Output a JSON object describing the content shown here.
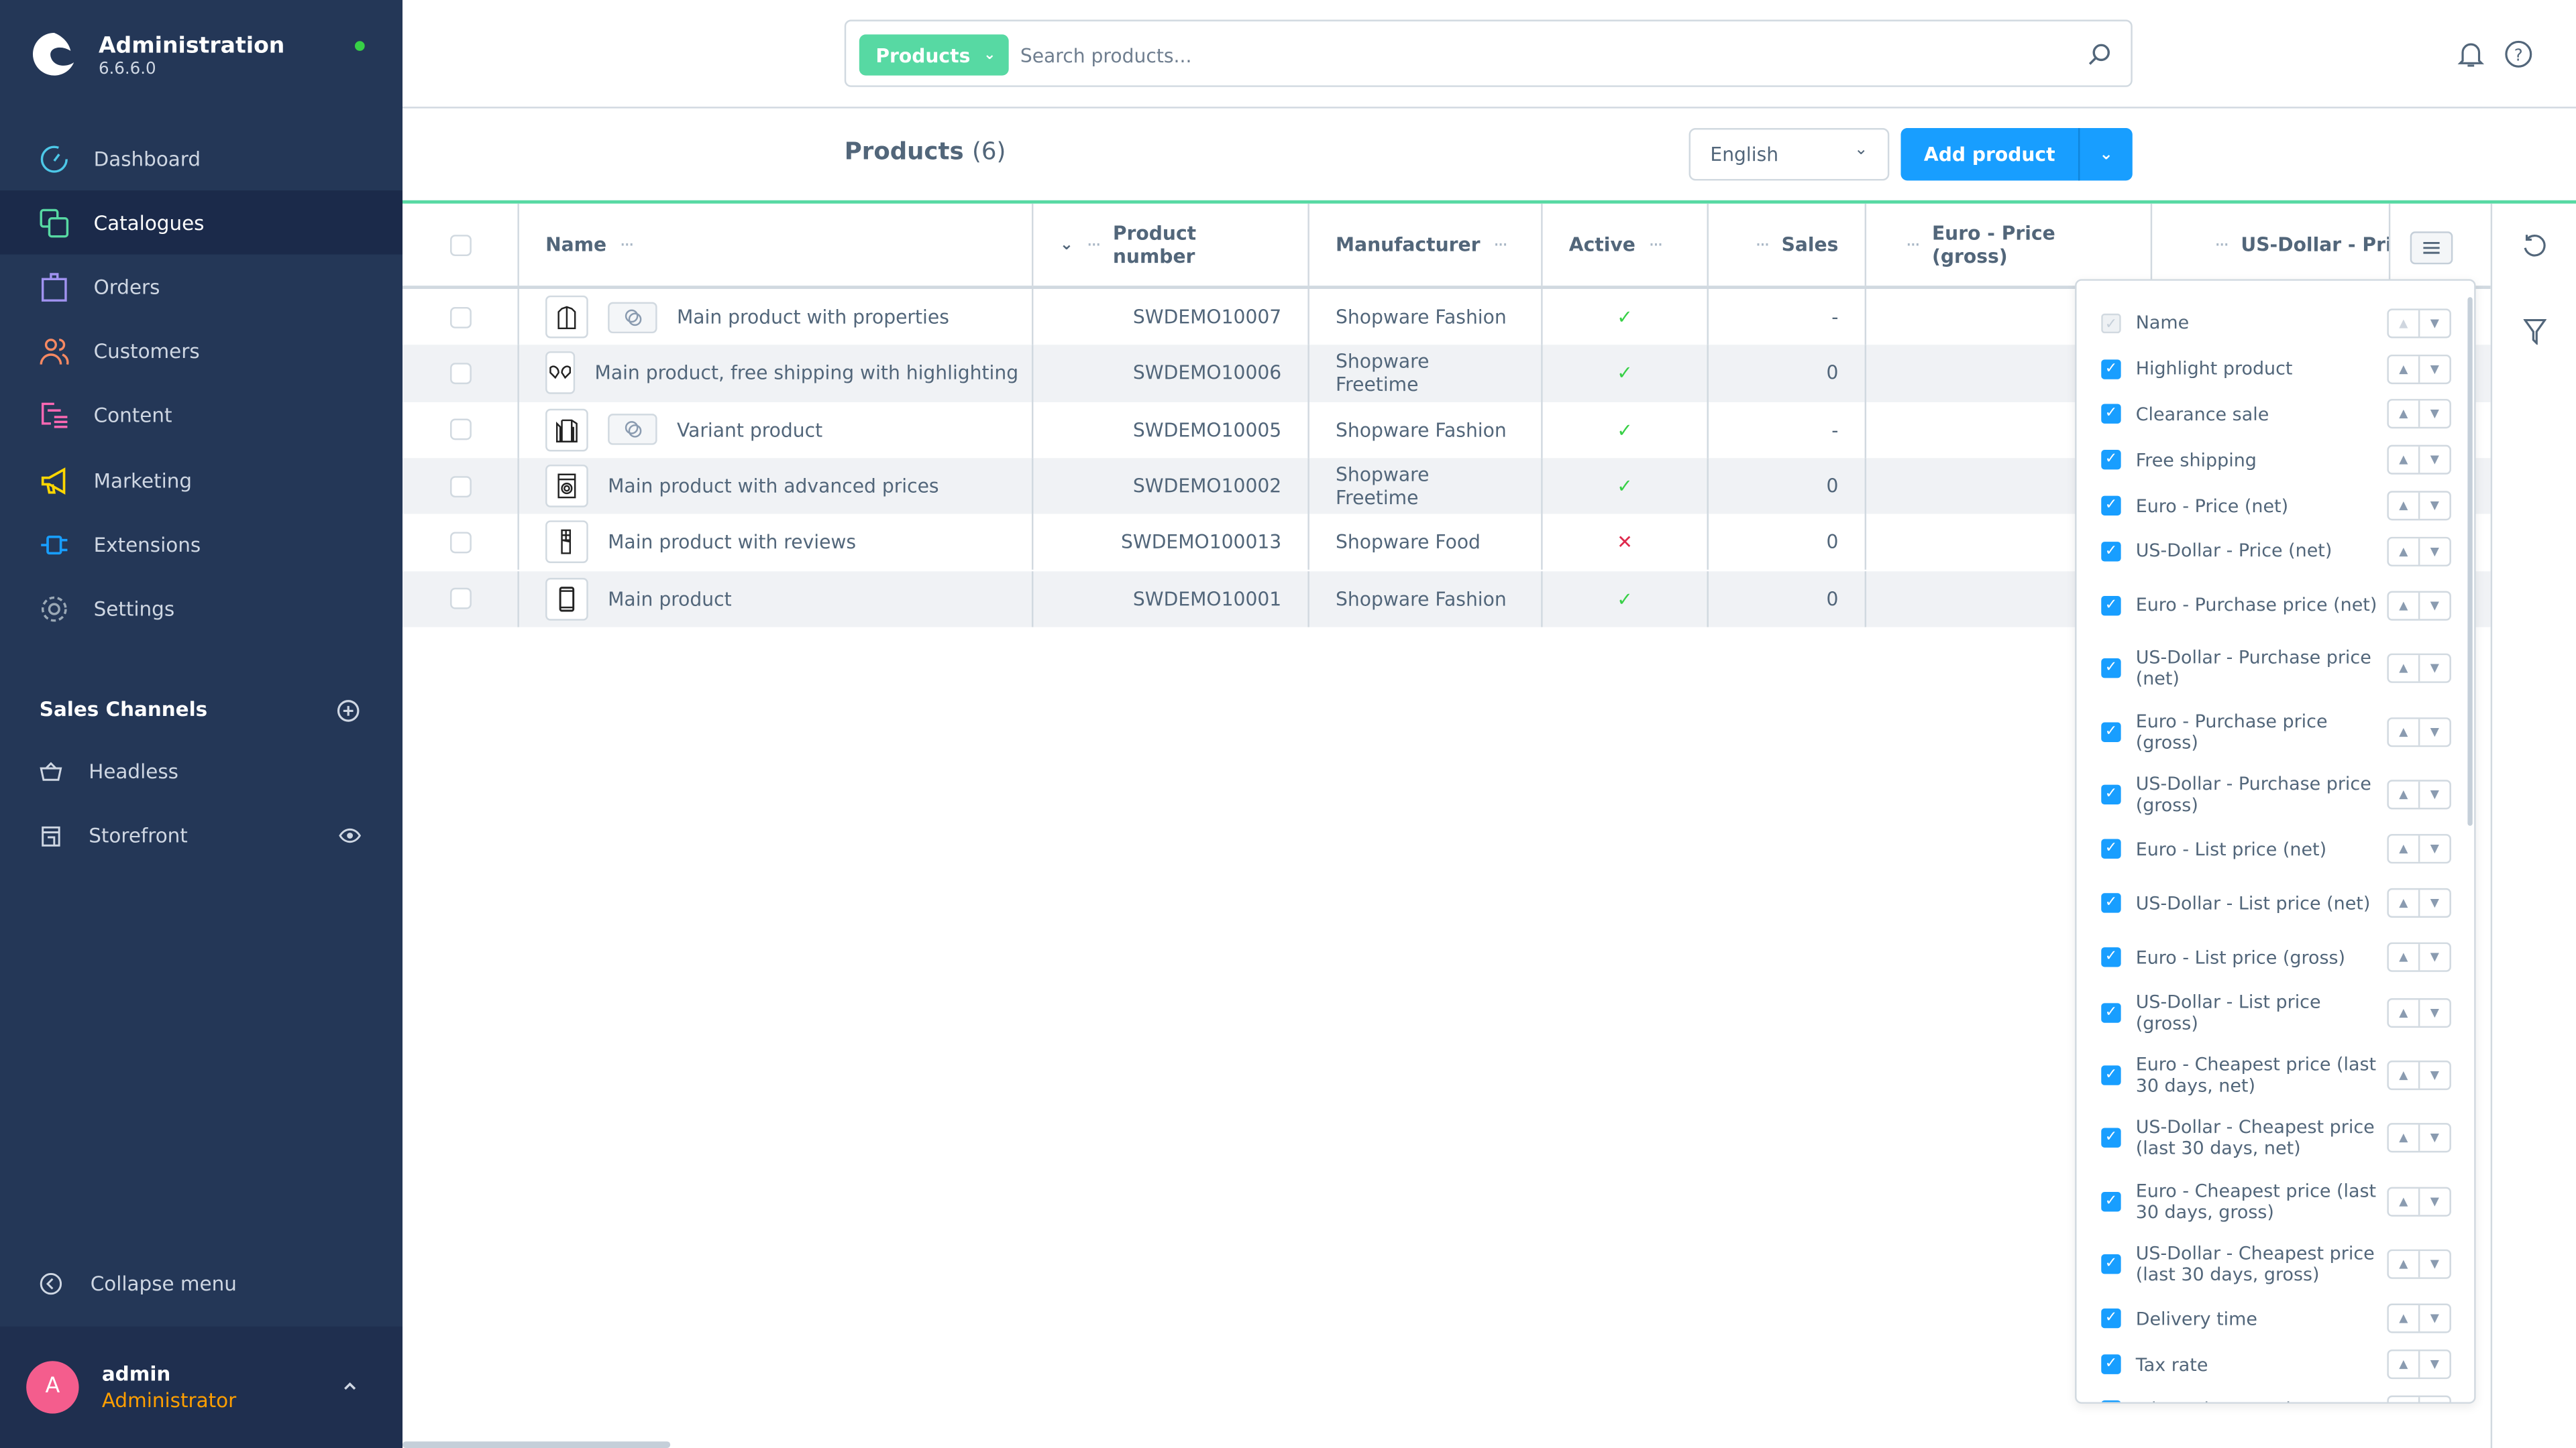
{
  "app": {
    "title": "Administration",
    "version": "6.6.6.0"
  },
  "sidebar": {
    "items": [
      {
        "label": "Dashboard",
        "icon": "dashboard-icon",
        "color": "#4dc8e8"
      },
      {
        "label": "Catalogues",
        "icon": "catalogues-icon",
        "color": "#57d9a3",
        "active": true
      },
      {
        "label": "Orders",
        "icon": "orders-icon",
        "color": "#a092f0"
      },
      {
        "label": "Customers",
        "icon": "customers-icon",
        "color": "#f88962"
      },
      {
        "label": "Content",
        "icon": "content-icon",
        "color": "#ff68b4"
      },
      {
        "label": "Marketing",
        "icon": "marketing-icon",
        "color": "#ffd700"
      },
      {
        "label": "Extensions",
        "icon": "extensions-icon",
        "color": "#189eff"
      },
      {
        "label": "Settings",
        "icon": "settings-icon",
        "color": "#9aa8b5"
      }
    ],
    "sales_channels_title": "Sales Channels",
    "sales_channels": [
      {
        "label": "Headless"
      },
      {
        "label": "Storefront"
      }
    ],
    "collapse_label": "Collapse menu",
    "user": {
      "initial": "A",
      "name": "admin",
      "role": "Administrator"
    }
  },
  "topbar": {
    "search_type": "Products",
    "search_placeholder": "Search products..."
  },
  "page": {
    "title": "Products",
    "count": "(6)",
    "language": "English",
    "add_label": "Add product"
  },
  "table": {
    "columns": [
      "Name",
      "Product number",
      "Manufacturer",
      "Active",
      "Sales",
      "Euro - Price (gross)",
      "US-Dollar - Pric"
    ],
    "rows": [
      {
        "name": "Main product with properties",
        "number": "SWDEMO10007",
        "manufacturer": "Shopware Fashion",
        "active": true,
        "sales": "-",
        "variant": true,
        "thumb": "jacket"
      },
      {
        "name": "Main product, free shipping with highlighting",
        "number": "SWDEMO10006",
        "manufacturer": "Shopware Freetime",
        "active": true,
        "sales": "0",
        "variant": false,
        "thumb": "gloves"
      },
      {
        "name": "Variant product",
        "number": "SWDEMO10005",
        "manufacturer": "Shopware Fashion",
        "active": true,
        "sales": "-",
        "variant": true,
        "thumb": "sweater"
      },
      {
        "name": "Main product with advanced prices",
        "number": "SWDEMO10002",
        "manufacturer": "Shopware Freetime",
        "active": true,
        "sales": "0",
        "variant": false,
        "thumb": "washing-machine"
      },
      {
        "name": "Main product with reviews",
        "number": "SWDEMO100013",
        "manufacturer": "Shopware Food",
        "active": false,
        "sales": "0",
        "variant": false,
        "thumb": "chocolate"
      },
      {
        "name": "Main product",
        "number": "SWDEMO10001",
        "manufacturer": "Shopware Fashion",
        "active": true,
        "sales": "0",
        "variant": false,
        "thumb": "phone"
      }
    ]
  },
  "column_settings": [
    {
      "label": "Name",
      "checked": true,
      "disabled": true
    },
    {
      "label": "Highlight product",
      "checked": true
    },
    {
      "label": "Clearance sale",
      "checked": true
    },
    {
      "label": "Free shipping",
      "checked": true
    },
    {
      "label": "Euro - Price (net)",
      "checked": true
    },
    {
      "label": "US-Dollar - Price (net)",
      "checked": true
    },
    {
      "label": "Euro - Purchase price (net)",
      "checked": true
    },
    {
      "label": "US-Dollar - Purchase price (net)",
      "checked": true
    },
    {
      "label": "Euro - Purchase price (gross)",
      "checked": true
    },
    {
      "label": "US-Dollar - Purchase price (gross)",
      "checked": true
    },
    {
      "label": "Euro - List price (net)",
      "checked": true
    },
    {
      "label": "US-Dollar - List price (net)",
      "checked": true
    },
    {
      "label": "Euro - List price (gross)",
      "checked": true
    },
    {
      "label": "US-Dollar - List price (gross)",
      "checked": true
    },
    {
      "label": "Euro - Cheapest price (last 30 days, net)",
      "checked": true
    },
    {
      "label": "US-Dollar - Cheapest price (last 30 days, net)",
      "checked": true
    },
    {
      "label": "Euro - Cheapest price (last 30 days, gross)",
      "checked": true
    },
    {
      "label": "US-Dollar - Cheapest price (last 30 days, gross)",
      "checked": true
    },
    {
      "label": "Delivery time",
      "checked": true
    },
    {
      "label": "Tax rate",
      "checked": true
    },
    {
      "label": "Min. order quantity",
      "checked": true
    }
  ]
}
